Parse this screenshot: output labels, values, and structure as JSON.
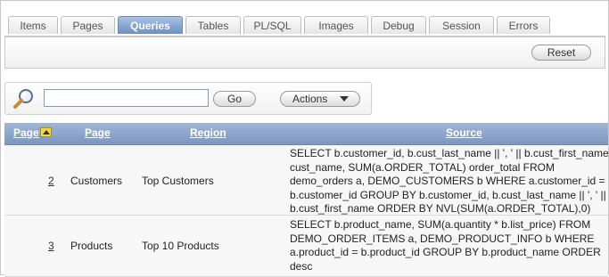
{
  "tabs": [
    {
      "label": "Items",
      "active": false
    },
    {
      "label": "Pages",
      "active": false
    },
    {
      "label": "Queries",
      "active": true
    },
    {
      "label": "Tables",
      "active": false
    },
    {
      "label": "PL/SQL",
      "active": false
    },
    {
      "label": "Images",
      "active": false
    },
    {
      "label": "Debug",
      "active": false
    },
    {
      "label": "Session",
      "active": false
    },
    {
      "label": "Errors",
      "active": false
    }
  ],
  "reset_label": "Reset",
  "search": {
    "value": "",
    "placeholder": "",
    "go_label": "Go",
    "actions_label": "Actions"
  },
  "table": {
    "columns": [
      "Page",
      "Page",
      "Region",
      "Source"
    ],
    "rows": [
      {
        "page_num": "2",
        "page_name": "Customers",
        "region": "Top Customers",
        "source": "SELECT b.customer_id, b.cust_last_name || ', ' || b.cust_first_name cust_name, SUM(a.ORDER_TOTAL) order_total FROM demo_orders a, DEMO_CUSTOMERS b WHERE a.customer_id = b.customer_id GROUP BY b.customer_id, b.cust_last_name || ', ' || b.cust_first_name ORDER BY NVL(SUM(a.ORDER_TOTAL),0) DESC"
      },
      {
        "page_num": "3",
        "page_name": "Products",
        "region": "Top 10 Products",
        "source": "SELECT b.product_name, SUM(a.quantity * b.list_price) FROM DEMO_ORDER_ITEMS a, DEMO_PRODUCT_INFO b WHERE a.product_id = b.product_id GROUP BY b.product_name ORDER desc"
      }
    ]
  },
  "colors": {
    "tab_active": "#7f9cc9",
    "header": "#8aa3ca",
    "row_bg": "#f7f7f7"
  }
}
